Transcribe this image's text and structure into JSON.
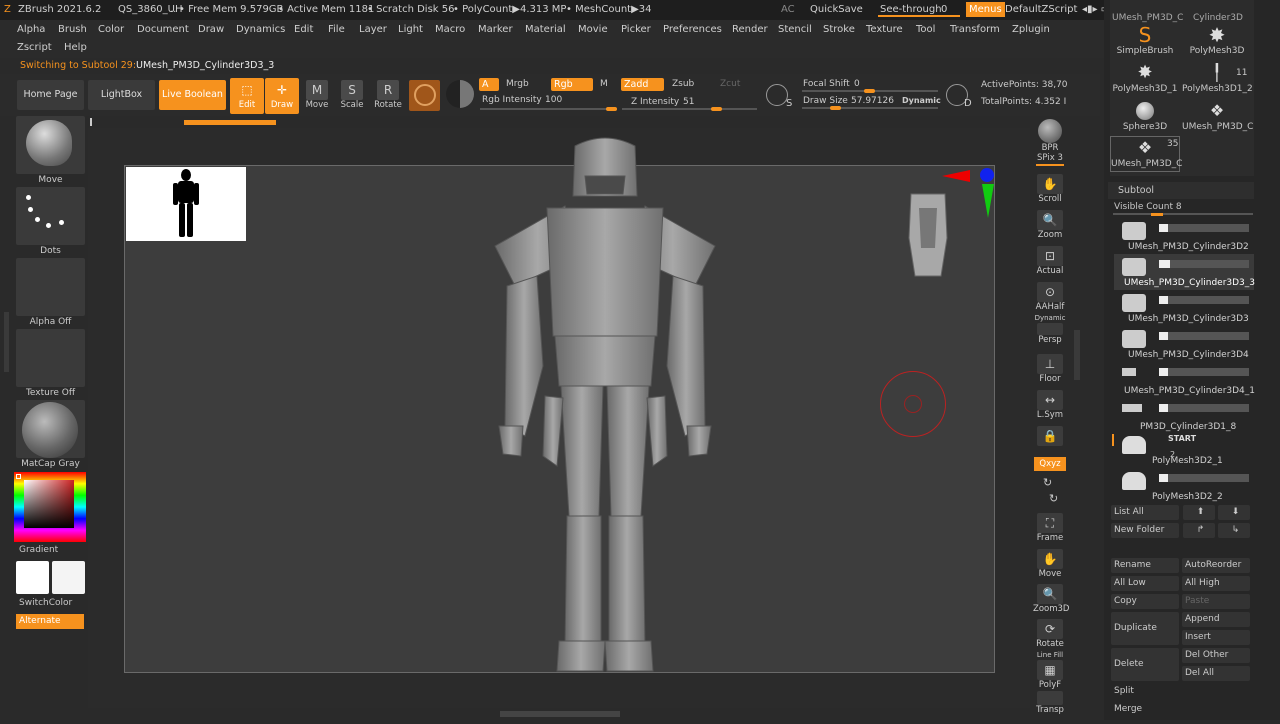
{
  "titlebar": {
    "app": "ZBrush 2021.6.2",
    "doc": "QS_3860_UH",
    "free_mem": "• Free Mem 9.579GB",
    "active_mem": "• Active Mem 1181",
    "scratch": "• Scratch Disk 56",
    "polycount": "• PolyCount▶4.313 MP",
    "meshcount": "• MeshCount▶34",
    "ac": "AC",
    "quicksave": "QuickSave",
    "see_through": "See-through",
    "see_through_val": "0",
    "menus": "Menus",
    "script": "DefaultZScript"
  },
  "menu": [
    "Alpha",
    "Brush",
    "Color",
    "Document",
    "Draw",
    "Dynamics",
    "Edit",
    "File",
    "Layer",
    "Light",
    "Macro",
    "Marker",
    "Material",
    "Movie",
    "Picker",
    "Preferences",
    "Render",
    "Stencil",
    "Stroke",
    "Texture",
    "Tool",
    "Transform",
    "Zplugin"
  ],
  "menu2": [
    "Zscript",
    "Help"
  ],
  "status": {
    "label": "Switching to Subtool 29:",
    "value": "UMesh_PM3D_Cylinder3D3_3"
  },
  "shelf": {
    "home": "Home Page",
    "lightbox": "LightBox",
    "live_boolean": "Live Boolean",
    "edit": "Edit",
    "draw": "Draw",
    "move": "Move",
    "scale": "Scale",
    "rotate": "Rotate",
    "a": "A",
    "mrgb": "Mrgb",
    "rgb": "Rgb",
    "m": "M",
    "rgb_intensity": "Rgb Intensity",
    "rgb_intensity_val": "100",
    "zadd": "Zadd",
    "zsub": "Zsub",
    "zcut": "Zcut",
    "z_intensity": "Z Intensity",
    "z_intensity_val": "51",
    "focal_shift": "Focal Shift",
    "focal_shift_val": "0",
    "draw_size": "Draw Size",
    "draw_size_val": "57.97126",
    "dynamic": "Dynamic",
    "active_points": "ActivePoints: 38,70",
    "total_points": "TotalPoints: 4.352 I",
    "s": "S",
    "d": "D"
  },
  "left": {
    "move": "Move",
    "dots": "Dots",
    "alpha_off": "Alpha Off",
    "texture_off": "Texture Off",
    "matcap": "MatCap Gray",
    "gradient": "Gradient",
    "switchcolor": "SwitchColor",
    "alternate": "Alternate"
  },
  "dock": {
    "bpr": "BPR",
    "spix": "SPix",
    "spix_val": "3",
    "scroll": "Scroll",
    "zoom": "Zoom",
    "actual": "Actual",
    "aahalf": "AAHalf",
    "dynamic": "Dynamic",
    "persp": "Persp",
    "floor": "Floor",
    "lsym": "L.Sym",
    "xyz": "Qxyz",
    "frame": "Frame",
    "move": "Move",
    "zoom3d": "Zoom3D",
    "rotate": "Rotate",
    "linefill": "Line Fill",
    "polyf": "PolyF",
    "transp": "Transp"
  },
  "tools": {
    "top_label": "UMesh_PM3D_C",
    "cyl": "Cylinder3D",
    "simple": "SimpleBrush",
    "poly": "PolyMesh3D",
    "poly1": "PolyMesh3D_1",
    "poly12": "PolyMesh3D1_2",
    "count11": "11",
    "sphere": "Sphere3D",
    "umesh": "UMesh_PM3D_C",
    "umesh2": "UMesh_PM3D_C",
    "count35": "35"
  },
  "subtool": {
    "title": "Subtool",
    "visible": "Visible Count",
    "visible_val": "8",
    "items": [
      "UMesh_PM3D_Cylinder3D2",
      "UMesh_PM3D_Cylinder3D3_3",
      "UMesh_PM3D_Cylinder3D3",
      "UMesh_PM3D_Cylinder3D4",
      "UMesh_PM3D_Cylinder3D4_1",
      "PM3D_Cylinder3D1_8",
      "PolyMesh3D2_1",
      "PolyMesh3D2_2"
    ],
    "start": "START",
    "two": "2"
  },
  "actions": {
    "list_all": "List All",
    "new_folder": "New Folder",
    "rename": "Rename",
    "autoreorder": "AutoReorder",
    "all_low": "All Low",
    "all_high": "All High",
    "copy": "Copy",
    "paste": "Paste",
    "append": "Append",
    "duplicate": "Duplicate",
    "insert": "Insert",
    "delete": "Delete",
    "del_other": "Del Other",
    "del_all": "Del All",
    "split": "Split",
    "merge": "Merge"
  }
}
